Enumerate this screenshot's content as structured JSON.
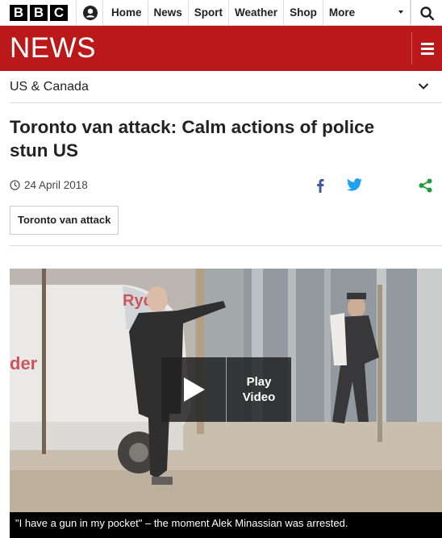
{
  "brand": {
    "logo_letters": [
      "B",
      "B",
      "C"
    ],
    "wordmark": "NEWS",
    "accent_color": "#bb1919"
  },
  "nav": {
    "items": [
      {
        "label": "Home"
      },
      {
        "label": "News"
      },
      {
        "label": "Sport"
      },
      {
        "label": "Weather"
      },
      {
        "label": "Shop"
      },
      {
        "label": "More"
      }
    ],
    "account_icon": "user-icon",
    "search_icon": "search-icon",
    "menu_icon": "hamburger-icon"
  },
  "section": {
    "name": "US & Canada",
    "icon": "chevron-down-icon"
  },
  "article": {
    "headline": "Toronto van attack: Calm actions of police stun US",
    "date": "24 April 2018",
    "tag": "Toronto van attack",
    "share_icons": [
      "facebook-icon",
      "twitter-icon",
      "share-icon"
    ]
  },
  "video": {
    "play_label_line1": "Play",
    "play_label_line2": "Video",
    "caption": "\"I have a gun in my pocket\" – the moment Alek Minassian was arrested."
  }
}
